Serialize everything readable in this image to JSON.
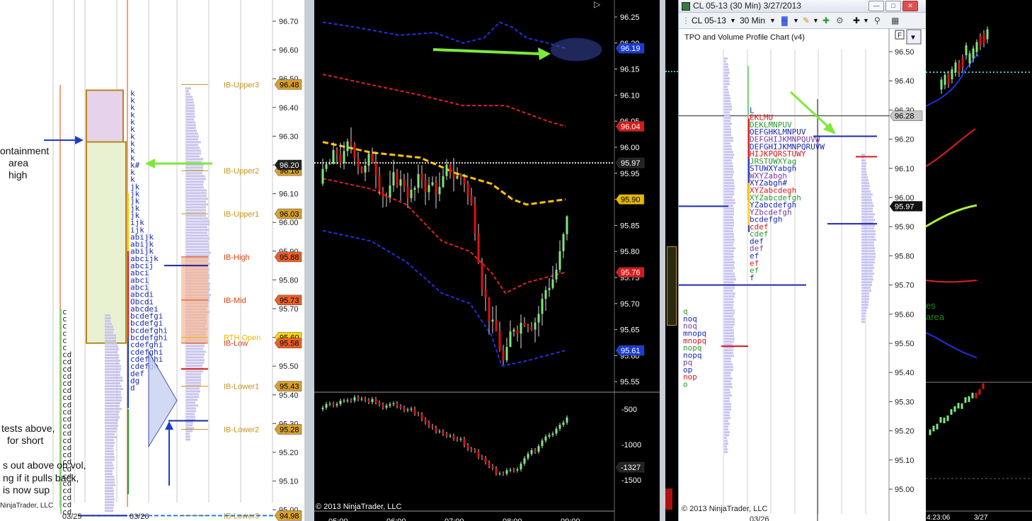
{
  "left_chart": {
    "price_ticks": [
      "96.70",
      "96.60",
      "96.50",
      "96.40",
      "96.30",
      "96.20",
      "96.10",
      "96.00",
      "95.90",
      "95.80",
      "95.70",
      "95.60",
      "95.50",
      "95.40",
      "95.30",
      "95.20",
      "95.10",
      "95.00"
    ],
    "levels": [
      {
        "name": "IB-Upper3",
        "tag": "96.48",
        "color": "#c8941c"
      },
      {
        "name": "IB-Upper2",
        "tag": "96.18",
        "color": "#c8941c"
      },
      {
        "name": "IB-Upper1",
        "tag": "96.03",
        "color": "#c8941c"
      },
      {
        "name": "IB-High",
        "tag": "95.88",
        "color": "#e04010"
      },
      {
        "name": "IB-Mid",
        "tag": "95.73",
        "color": "#e04010"
      },
      {
        "name": "RTH Open",
        "tag": "95.60",
        "color": "#e6b800"
      },
      {
        "name": "IB-Low",
        "tag": "95.58",
        "color": "#e04010"
      },
      {
        "name": "IB-Lower1",
        "tag": "95.43",
        "color": "#c8941c"
      },
      {
        "name": "IB-Lower2",
        "tag": "95.28",
        "color": "#c8941c"
      },
      {
        "name": "IB-Lower3",
        "tag": "94.98",
        "color": "#c8941c"
      }
    ],
    "current_price_tag": "96.20",
    "annotation_high": "ontainment\narea\nhigh",
    "annotation_lines": [
      "tests above,",
      "for short",
      "s out above on vol,",
      "ng if it pulls back,",
      "is now sup"
    ],
    "copyright": "NinjaTrader, LLC",
    "dates": [
      "03/25",
      "03/26"
    ],
    "tpo_day1": [
      "c",
      "c",
      "c",
      "c",
      "c",
      "c",
      "cd",
      "cd",
      "cd",
      "cd",
      "cd",
      "cd",
      "cd",
      "cd",
      "cd",
      "cd",
      "cd",
      "cd",
      "cd",
      "cd",
      "cd",
      "cd",
      "cd",
      "cd",
      "cd",
      "cd",
      "cd",
      "cd",
      "cd"
    ],
    "tpo_day2": [
      "k",
      "k",
      "k",
      "k",
      "k",
      "k",
      "k",
      "k",
      "k",
      "k",
      "k#",
      "k",
      "k",
      "jk",
      "jk",
      "jk",
      "jk",
      "jk",
      "ijk",
      "ijk",
      "abijk",
      "abijk",
      "abijk",
      "abcijk",
      "abcij",
      "abci",
      "abci",
      "abci",
      "abcdi",
      "Obcdi",
      "abcdei",
      "bcdefgi",
      "bcdefgi",
      "bcdefghi",
      "bcdefghi",
      "cdefghi",
      "cdefghi",
      "cdefghi",
      "cdefgh",
      "def",
      "dg",
      "d"
    ]
  },
  "middle_chart": {
    "price_ticks": [
      "96.25",
      "96.20",
      "96.15",
      "96.10",
      "96.05",
      "96.00",
      "95.95",
      "95.90",
      "95.85",
      "95.80",
      "95.75",
      "95.70",
      "95.65",
      "95.60",
      "95.55"
    ],
    "price_tags": [
      {
        "label": "96.19",
        "color": "#1a3cd6"
      },
      {
        "label": "96.04",
        "color": "#d61a1a"
      },
      {
        "label": "95.97",
        "color": "#222222"
      },
      {
        "label": "95.90",
        "color": "#e6b800"
      },
      {
        "label": "95.76",
        "color": "#d61a1a"
      },
      {
        "label": "95.61",
        "color": "#1a3cd6"
      }
    ],
    "lower_ticks": [
      "-500",
      "-1000",
      "-1500"
    ],
    "lower_tag": "-1327",
    "time_ticks": [
      "05:00",
      "06:00",
      "07:00",
      "08:00",
      "09:00"
    ],
    "copyright": "© 2013 NinjaTrader, LLC"
  },
  "tpo_window": {
    "title": "CL 05-13 (30 Min)  3/27/2013",
    "toolbar": {
      "instrument": "CL 05-13",
      "interval": "30 Min"
    },
    "chart_label": "TPO and Volume Profile Chart (v4)",
    "price_ticks": [
      "96.50",
      "96.40",
      "96.30",
      "96.20",
      "96.10",
      "96.00",
      "95.90",
      "95.80",
      "95.70",
      "95.60",
      "95.50",
      "95.40",
      "95.30",
      "95.20",
      "95.10",
      "95.00"
    ],
    "price_tag_gray": "96.28",
    "price_tag_black": "95.97",
    "copyright": "© 2013 NinjaTrader, LLC",
    "date": "03/26",
    "tpo_upper": [
      "L",
      "EKLMU",
      "DEKLMNPUV",
      "OEFGHKLMNPUV",
      "DEFGHIJKMNPQUVW",
      "DEFGHIJKMNPQRUVW",
      "HIJKPQRSTUWY",
      "JRSTUWXYag",
      "STUWXYabgh",
      "WXYZabgh",
      "XYZabgh#",
      "XYZabcdegh",
      "XYZabcdefgh",
      "YZabcdefgh",
      "YZbcdefgh",
      "bcdefgh",
      "cdef",
      "cdef",
      "def",
      "def",
      "ef",
      "ef",
      "ef",
      "f"
    ],
    "tpo_lower": [
      "q",
      "noq",
      "noq",
      "mnopq",
      "mnopq",
      "nopq",
      "nopq",
      "pq",
      "op",
      "nop",
      "o"
    ]
  },
  "right_chart": {
    "time_label": "4:23:06",
    "date_label": "3/27",
    "bg_text": [
      "es",
      "area"
    ]
  }
}
